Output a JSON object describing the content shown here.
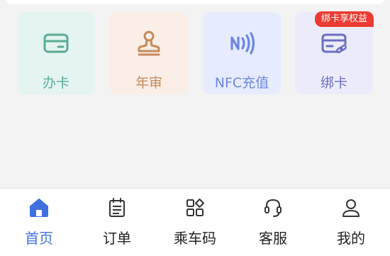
{
  "colors": {
    "accent": "#3f70e0",
    "badge": "#eb3b32",
    "apply_card": "#5aab92",
    "annual_review": "#c58a5c",
    "nfc_recharge": "#6c86e4",
    "bind_card": "#6b6fbf"
  },
  "services": [
    {
      "label": "办卡",
      "icon": "card-icon"
    },
    {
      "label": "年审",
      "icon": "stamp-icon"
    },
    {
      "label": "NFC充值",
      "icon": "nfc-icon"
    },
    {
      "label": "绑卡",
      "icon": "bind-card-icon",
      "badge": "绑卡享权益"
    }
  ],
  "tabbar": {
    "active_index": 0,
    "tabs": [
      {
        "label": "首页",
        "icon": "home-icon"
      },
      {
        "label": "订单",
        "icon": "order-list-icon"
      },
      {
        "label": "乘车码",
        "icon": "ride-code-icon"
      },
      {
        "label": "客服",
        "icon": "headset-icon"
      },
      {
        "label": "我的",
        "icon": "profile-icon"
      }
    ]
  }
}
